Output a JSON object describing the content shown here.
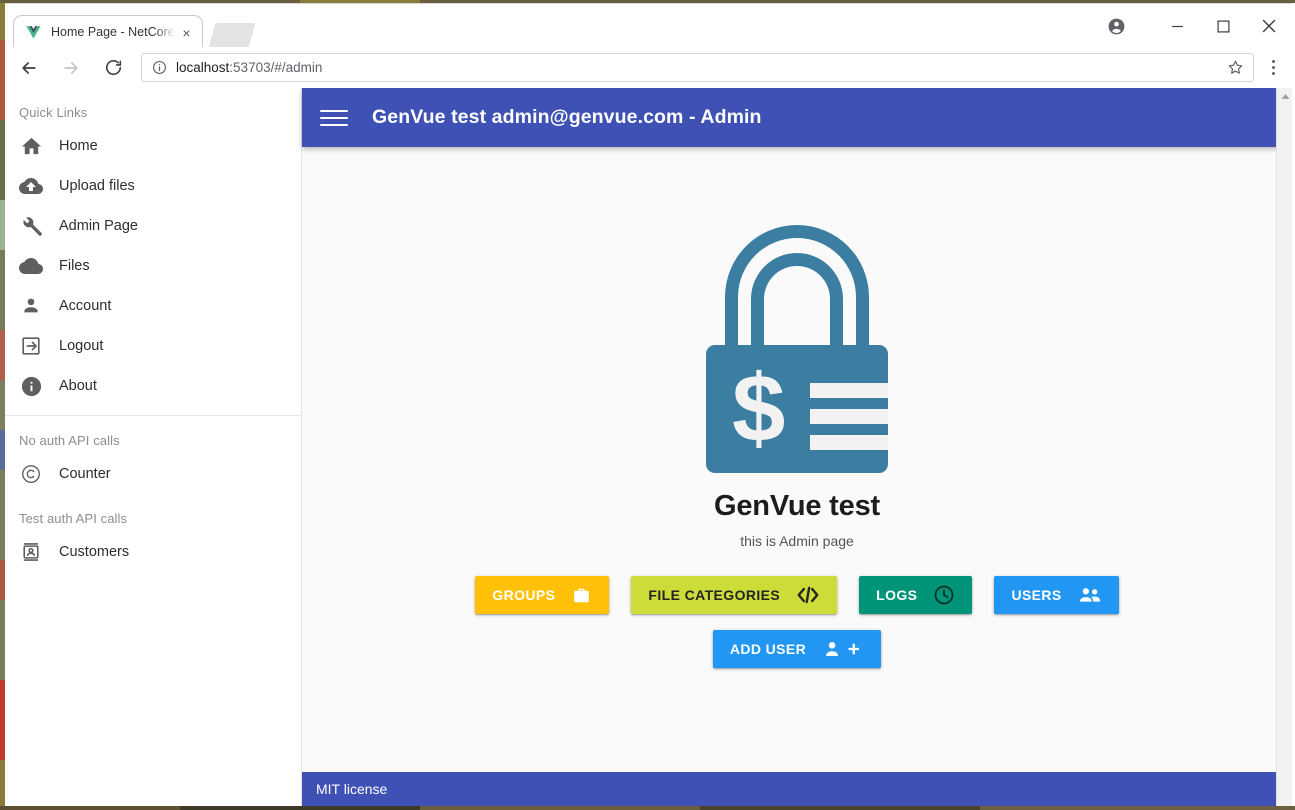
{
  "browser": {
    "tab": {
      "title": "Home Page - NetCore, Vu",
      "favicon": "vue-logo-icon",
      "close": "×"
    },
    "url": {
      "scheme_host": "localhost",
      "rest": ":53703/#/admin",
      "full": "localhost:53703/#/admin"
    },
    "controls": {
      "back": "back-arrow",
      "forward": "forward-arrow",
      "reload": "reload-icon",
      "info": "site-info-icon",
      "star": "bookmark-star-icon",
      "menu": "chrome-menu-icon",
      "profile": "profile-avatar-icon",
      "minimize": "—",
      "maximize": "□",
      "close": "✕"
    }
  },
  "sidebar": {
    "sections": [
      {
        "title": "Quick Links",
        "items": [
          {
            "label": "Home",
            "icon": "home-icon"
          },
          {
            "label": "Upload files",
            "icon": "cloud-upload-icon"
          },
          {
            "label": "Admin Page",
            "icon": "wrench-icon"
          },
          {
            "label": "Files",
            "icon": "cloud-icon"
          },
          {
            "label": "Account",
            "icon": "person-icon"
          },
          {
            "label": "Logout",
            "icon": "logout-icon"
          },
          {
            "label": "About",
            "icon": "info-circle-icon"
          }
        ]
      },
      {
        "title": "No auth API calls",
        "items": [
          {
            "label": "Counter",
            "icon": "copyright-icon"
          }
        ]
      },
      {
        "title": "Test auth API calls",
        "items": [
          {
            "label": "Customers",
            "icon": "contact-card-icon"
          }
        ]
      }
    ]
  },
  "app": {
    "toolbar": {
      "menu_icon": "hamburger-icon",
      "title": "GenVue test admin@genvue.com - Admin"
    },
    "logo": {
      "name": "padlock-dollar-logo",
      "symbol": "$"
    },
    "heading": "GenVue test",
    "subheading": "this is Admin page",
    "buttons": [
      {
        "label": "GROUPS",
        "icon": "briefcase-icon",
        "bg": "#ffc107",
        "fg": "#ffffff"
      },
      {
        "label": "FILE CATEGORIES",
        "icon": "code-icon",
        "bg": "#cddc39",
        "fg": "#242424"
      },
      {
        "label": "LOGS",
        "icon": "clock-icon",
        "bg": "#009578",
        "fg": "#ffffff"
      },
      {
        "label": "USERS",
        "icon": "people-icon",
        "bg": "#2196f3",
        "fg": "#ffffff"
      }
    ],
    "buttons_second_row": [
      {
        "label": "ADD USER",
        "icon": "person-add-icon",
        "bg": "#2196f3",
        "fg": "#ffffff"
      }
    ],
    "footer": "MIT license"
  },
  "colors": {
    "app_bar": "#3f51b5",
    "logo": "#3b7ea1",
    "page_bg": "#fafafa"
  }
}
